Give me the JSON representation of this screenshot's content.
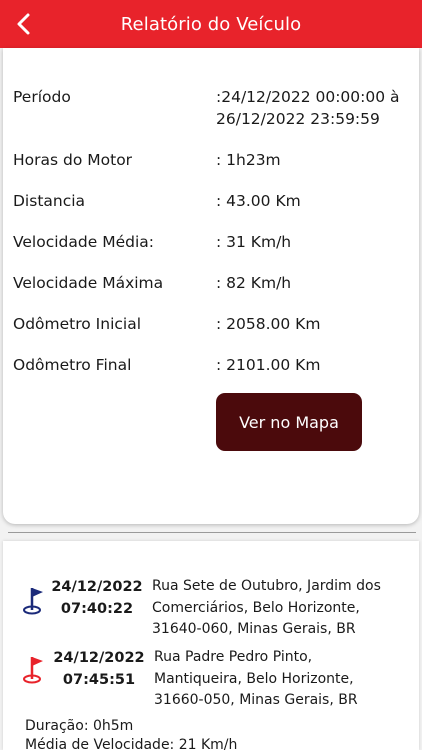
{
  "header": {
    "title": "Relatório do Veículo"
  },
  "report": {
    "rows": [
      {
        "label": "Período",
        "value_line1": ":24/12/2022 00:00:00 à",
        "value_line2": "26/12/2022 23:59:59"
      },
      {
        "label": "Horas do Motor",
        "value": ": 1h23m"
      },
      {
        "label": "Distancia",
        "value": ": 43.00 Km"
      },
      {
        "label": "Velocidade Média:",
        "value": ": 31 Km/h"
      },
      {
        "label": "Velocidade Máxima",
        "value": ": 82 Km/h"
      },
      {
        "label": "Odômetro Inicial",
        "value": ": 2058.00 Km"
      },
      {
        "label": "Odômetro Final",
        "value": ": 2101.00 Km"
      }
    ],
    "map_button_label": "Ver no Mapa"
  },
  "trip": {
    "start": {
      "date": "24/12/2022",
      "time": "07:40:22",
      "address_lines": [
        "Rua Sete de Outubro, Jardim dos",
        "Comerciários, Belo Horizonte,",
        "31640-060, Minas Gerais, BR"
      ],
      "flag_icon": "start-flag-icon",
      "flag_color": "#1b2a7a"
    },
    "end": {
      "date": "24/12/2022",
      "time": "07:45:51",
      "address_lines": [
        "Rua Padre Pedro Pinto,",
        "Mantiqueira, Belo Horizonte,",
        "31660-050, Minas Gerais, BR"
      ],
      "flag_icon": "end-flag-icon",
      "flag_color": "#e8232b"
    },
    "duration": "Duração: 0h5m",
    "avg_speed": "Média de Velocidade: 21 Km/h"
  },
  "colors": {
    "header": "#e8232b",
    "map_button": "#4b0a0c"
  }
}
